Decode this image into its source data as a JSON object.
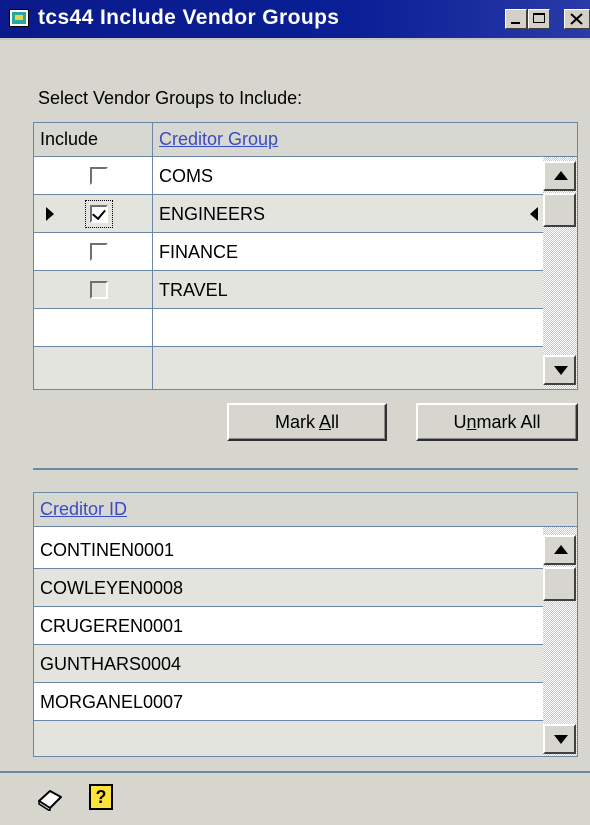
{
  "window": {
    "title": "tcs44 Include Vendor  Groups",
    "controls": [
      "minimize",
      "maximize",
      "close"
    ]
  },
  "prompt": "Select Vendor Groups to Include:",
  "vendor_groups_grid": {
    "columns": {
      "include": "Include",
      "creditor_group": "Creditor Group"
    },
    "rows": [
      {
        "checked": false,
        "group": "COMS"
      },
      {
        "checked": true,
        "group": "ENGINEERS",
        "current": true
      },
      {
        "checked": false,
        "group": "FINANCE"
      },
      {
        "checked": false,
        "group": "TRAVEL"
      },
      {
        "checked": null,
        "group": ""
      },
      {
        "checked": null,
        "group": ""
      }
    ]
  },
  "buttons": {
    "mark_all": {
      "pre": "Mark ",
      "accel": "A",
      "post": "ll"
    },
    "unmark_all": {
      "pre": "U",
      "accel": "n",
      "post": "mark All"
    }
  },
  "creditor_grid": {
    "column": "Creditor ID",
    "rows": [
      "CONTINEN0001",
      "COWLEYEN0008",
      "CRUGEREN0001",
      "GUNTHARS0004",
      "MORGANEL0007",
      ""
    ]
  },
  "footer": {
    "icons": [
      "note-icon",
      "help-icon"
    ],
    "help_glyph": "?"
  },
  "colors": {
    "titlebar": "#0a1a8a",
    "header_link": "#3a4cc0",
    "grid_lines": "#6a86a8",
    "face": "#d6d6cf"
  }
}
